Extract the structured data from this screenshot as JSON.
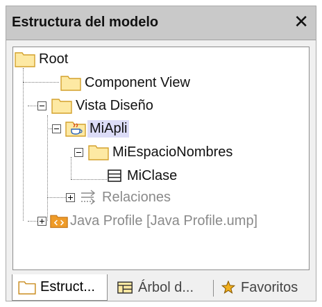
{
  "panel": {
    "title": "Estructura del modelo",
    "close_glyph": "✕"
  },
  "tree": {
    "root": "Root",
    "component_view": "Component View",
    "vista_diseno": "Vista Diseño",
    "miapli": "MiApli",
    "miespacio": "MiEspacioNombres",
    "miclase": "MiClase",
    "relaciones": "Relaciones",
    "java_profile": "Java Profile [Java Profile.ump]"
  },
  "tabs": [
    {
      "label": "Estruct...",
      "icon": "folder-outline-icon",
      "active": true
    },
    {
      "label": "Árbol d...",
      "icon": "diagram-tree-icon",
      "active": false
    },
    {
      "label": "Favoritos",
      "icon": "favorites-star-icon",
      "active": false
    }
  ],
  "colors": {
    "folder_fill": "#fde9a3",
    "folder_stroke": "#d3a12c",
    "selection": "#dcdcf7",
    "package_orange": "#ef9b28"
  }
}
